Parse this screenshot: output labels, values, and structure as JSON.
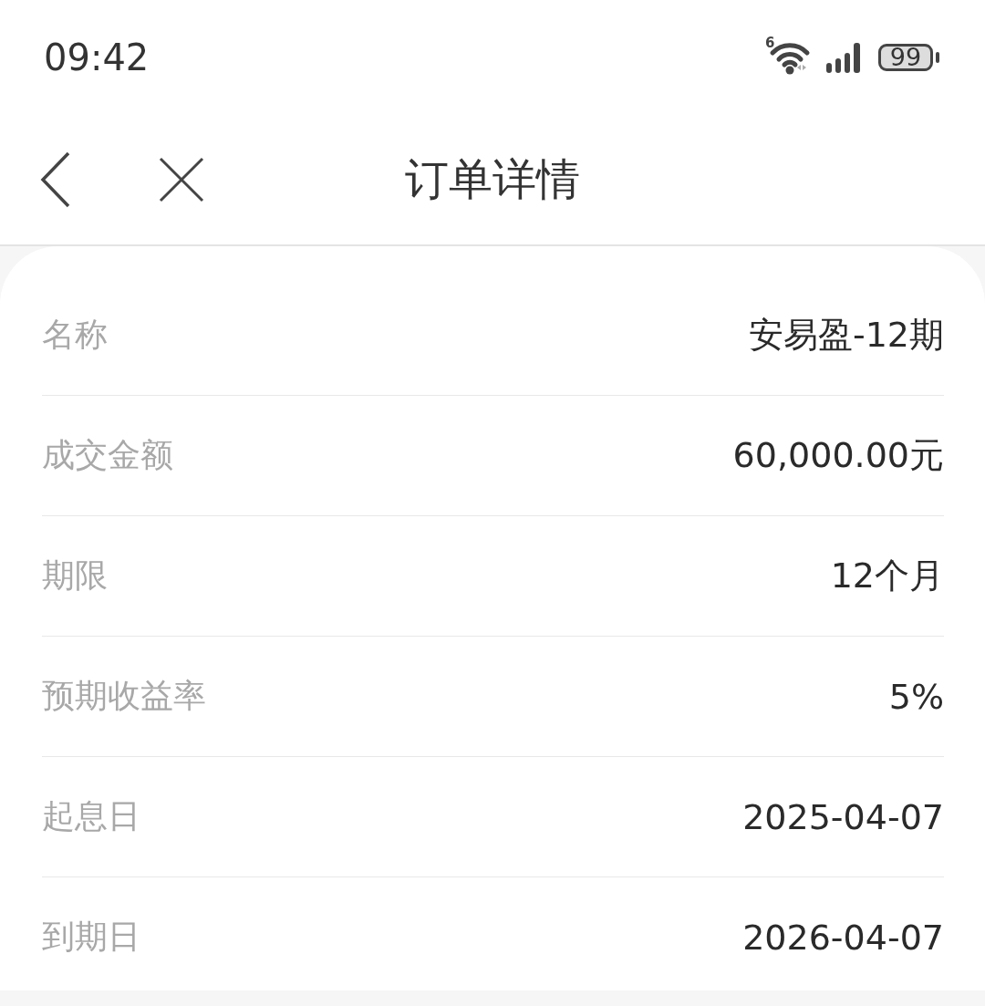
{
  "status_bar": {
    "time": "09:42",
    "wifi_label": "6",
    "battery": "99"
  },
  "nav": {
    "title": "订单详情"
  },
  "details": [
    {
      "label": "名称",
      "value": "安易盈-12期"
    },
    {
      "label": "成交金额",
      "value": "60,000.00元"
    },
    {
      "label": "期限",
      "value": "12个月"
    },
    {
      "label": "预期收益率",
      "value": "5%"
    },
    {
      "label": "起息日",
      "value": "2025-04-07"
    },
    {
      "label": "到期日",
      "value": "2026-04-07"
    }
  ]
}
